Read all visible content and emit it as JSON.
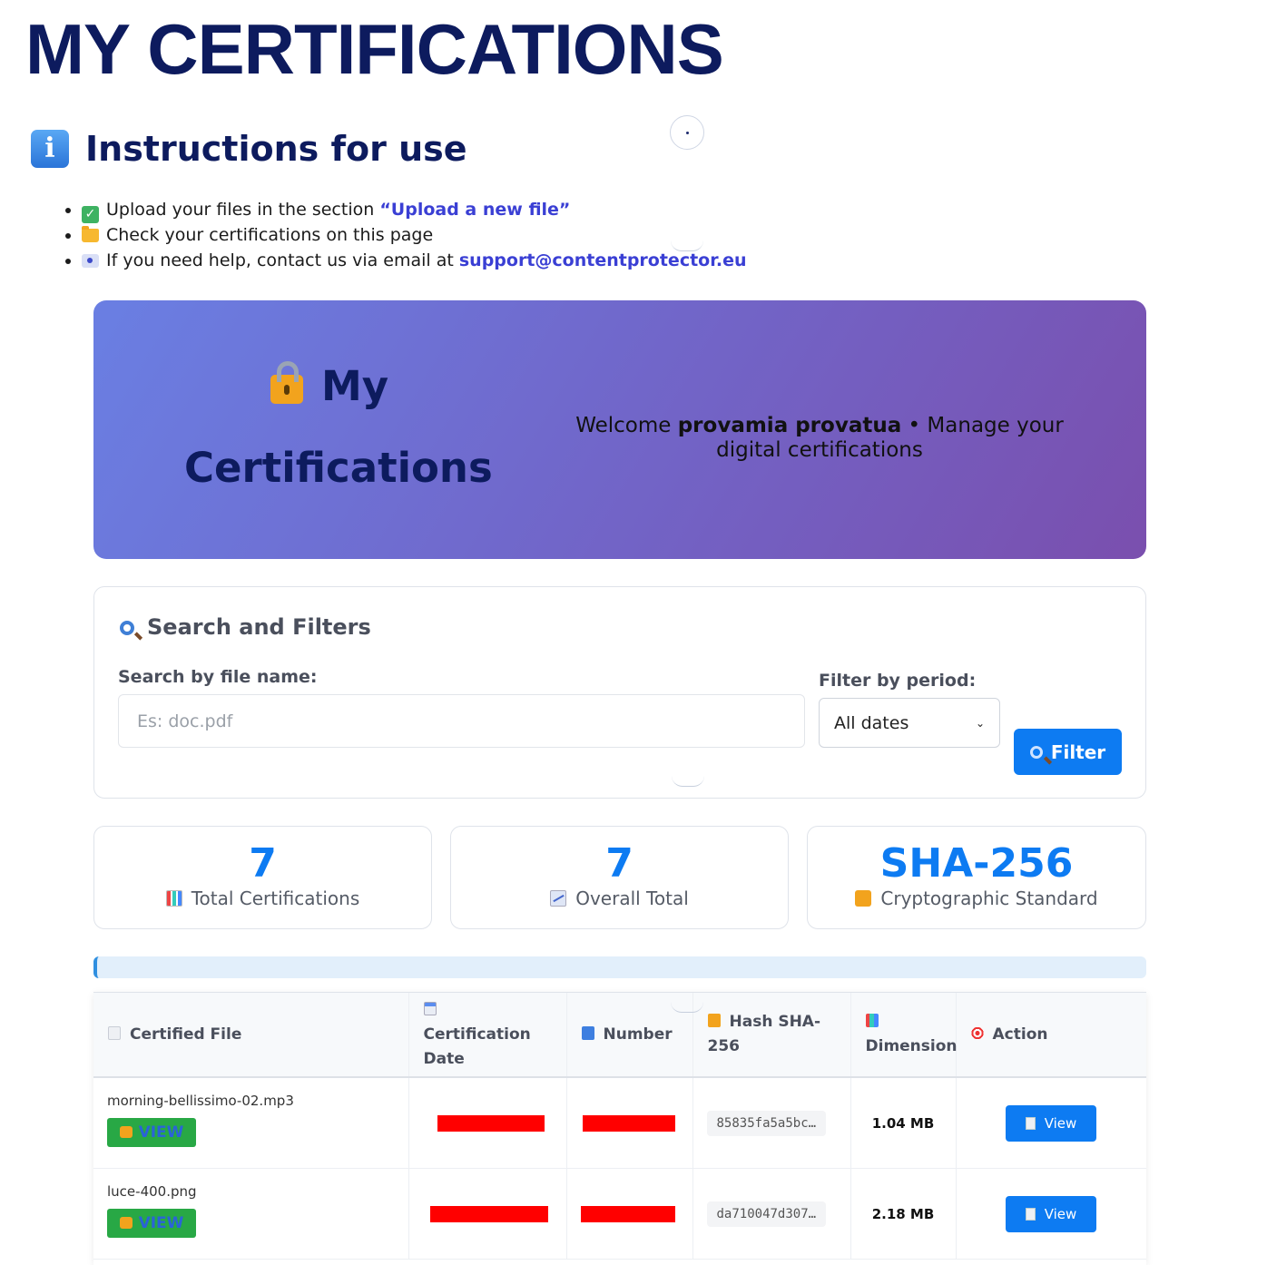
{
  "page": {
    "title": "MY CERTIFICATIONS"
  },
  "instructions": {
    "title": "Instructions for use",
    "items": [
      {
        "icon": "check-icon",
        "text": "Upload your files in the section ",
        "link": "“Upload a new file”"
      },
      {
        "icon": "folder-icon",
        "text": "Check your certifications on this page",
        "link": ""
      },
      {
        "icon": "email-icon",
        "text": "If you need help, contact us via email at ",
        "link": "support@contentprotector.eu"
      }
    ]
  },
  "hero": {
    "title_line1": "My",
    "title_line2": "Certifications",
    "welcome_prefix": "Welcome ",
    "user_name": "provamia provatua",
    "welcome_suffix": " • Manage your digital certifications"
  },
  "search": {
    "heading": "Search and Filters",
    "file_label": "Search by file name:",
    "file_placeholder": "Es: doc.pdf",
    "file_value": "",
    "period_label": "Filter by period:",
    "period_value": "All dates",
    "filter_button": "Filter"
  },
  "stats": [
    {
      "value": "7",
      "label": "Total Certifications",
      "icon": "bar-chart-icon"
    },
    {
      "value": "7",
      "label": "Overall Total",
      "icon": "trend-chart-icon"
    },
    {
      "value": "SHA-256",
      "label": "Cryptographic Standard",
      "icon": "lock-icon"
    }
  ],
  "table": {
    "headers": {
      "file": "Certified File",
      "date": "Certification Date",
      "number": "Number",
      "hash": "Hash SHA-256",
      "dimension": "Dimension",
      "action": "Action"
    },
    "rows": [
      {
        "file": "morning-bellissimo-02.mp3",
        "view_badge": "VIEW",
        "hash": "85835fa5a5bc…",
        "dimension": "1.04 MB",
        "action": "View"
      },
      {
        "file": "luce-400.png",
        "view_badge": "VIEW",
        "hash": "da710047d307…",
        "dimension": "2.18 MB",
        "action": "View"
      }
    ]
  },
  "colors": {
    "primary": "#0d7bf2",
    "navy": "#0d1b5e",
    "green": "#28a845",
    "redaction": "#ff0000"
  }
}
